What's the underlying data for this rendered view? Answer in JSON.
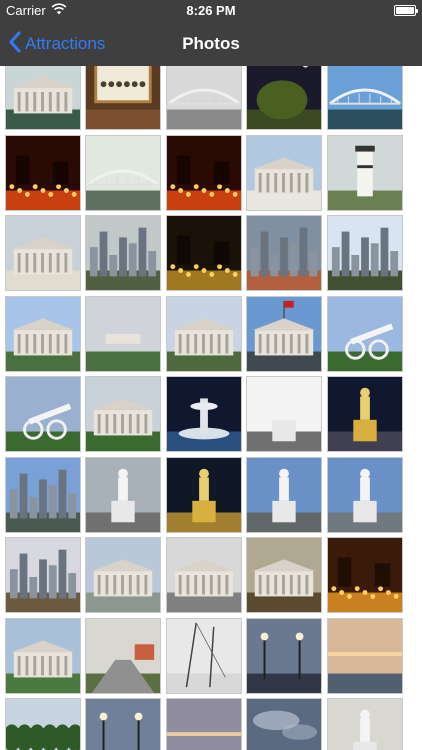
{
  "status_bar": {
    "carrier": "Carrier",
    "time": "8:26 PM",
    "wifi_icon": "wifi-icon",
    "battery_icon": "battery-icon",
    "battery_level": 1.0
  },
  "nav": {
    "back_label": "Attractions",
    "back_icon": "chevron-left-icon",
    "title": "Photos",
    "bar_color": "#3f3f3f",
    "accent_color": "#2f7cf6"
  },
  "photos": [
    {
      "sky": "#c9d6d6",
      "ground": "#3a5a4a",
      "subject": "building"
    },
    {
      "sky": "#5a3a20",
      "ground": "#7a5030",
      "subject": "framed-photo"
    },
    {
      "sky": "#d8d8d8",
      "ground": "#8a8a8a",
      "subject": "bridge"
    },
    {
      "sky": "#1a1a2a",
      "ground": "#3b4a20",
      "subject": "night-tree"
    },
    {
      "sky": "#6aa0d8",
      "ground": "#2a5060",
      "subject": "bridge"
    },
    {
      "sky": "#2a0a05",
      "ground": "#c84010",
      "subject": "night-lights"
    },
    {
      "sky": "#e0e8e0",
      "ground": "#607060",
      "subject": "bridge"
    },
    {
      "sky": "#2a0a05",
      "ground": "#c84010",
      "subject": "night-lights"
    },
    {
      "sky": "#b0c8e0",
      "ground": "#e8e8e0",
      "subject": "building"
    },
    {
      "sky": "#d0d8d8",
      "ground": "#6a8050",
      "subject": "tower"
    },
    {
      "sky": "#c8d0d8",
      "ground": "#e0dcd0",
      "subject": "building"
    },
    {
      "sky": "#c0c8c8",
      "ground": "#506040",
      "subject": "skyline"
    },
    {
      "sky": "#1a1208",
      "ground": "#a07820",
      "subject": "night-lights"
    },
    {
      "sky": "#8090a0",
      "ground": "#b06040",
      "subject": "skyline"
    },
    {
      "sky": "#d8e4f0",
      "ground": "#405030",
      "subject": "skyline"
    },
    {
      "sky": "#a8c4e8",
      "ground": "#4a7040",
      "subject": "building"
    },
    {
      "sky": "#d0d4d8",
      "ground": "#4a7040",
      "subject": "lawn"
    },
    {
      "sky": "#c8d4e4",
      "ground": "#506a40",
      "subject": "building"
    },
    {
      "sky": "#6a98d0",
      "ground": "#404850",
      "subject": "flag-building"
    },
    {
      "sky": "#9ab8e0",
      "ground": "#3a6a30",
      "subject": "cannon"
    },
    {
      "sky": "#9ab0d0",
      "ground": "#3a6a30",
      "subject": "cannon"
    },
    {
      "sky": "#c8d0d8",
      "ground": "#3a6a30",
      "subject": "building"
    },
    {
      "sky": "#101830",
      "ground": "#2a5080",
      "subject": "fountain"
    },
    {
      "sky": "#f4f4f4",
      "ground": "#707070",
      "subject": "statue"
    },
    {
      "sky": "#101830",
      "ground": "#404050",
      "subject": "statue-night"
    },
    {
      "sky": "#7aa0d8",
      "ground": "#4a5a50",
      "subject": "skyline"
    },
    {
      "sky": "#a8b0b8",
      "ground": "#707070",
      "subject": "statue"
    },
    {
      "sky": "#101828",
      "ground": "#a08030",
      "subject": "statue-night"
    },
    {
      "sky": "#6a90c8",
      "ground": "#606868",
      "subject": "statue"
    },
    {
      "sky": "#6a90c8",
      "ground": "#707880",
      "subject": "statue"
    },
    {
      "sky": "#d8d8e0",
      "ground": "#6a5a40",
      "subject": "skyline"
    },
    {
      "sky": "#b8c8d8",
      "ground": "#8a9890",
      "subject": "building"
    },
    {
      "sky": "#d8d8d8",
      "ground": "#808080",
      "subject": "building"
    },
    {
      "sky": "#b0a890",
      "ground": "#5a4a30",
      "subject": "building"
    },
    {
      "sky": "#3a1a08",
      "ground": "#c88020",
      "subject": "night-lights"
    },
    {
      "sky": "#a8c0d8",
      "ground": "#4a7a40",
      "subject": "building"
    },
    {
      "sky": "#d8d8d0",
      "ground": "#5a7040",
      "subject": "street"
    },
    {
      "sky": "#e8e8e8",
      "ground": "#d8d8d8",
      "subject": "masts"
    },
    {
      "sky": "#6a7890",
      "ground": "#303848",
      "subject": "lamps"
    },
    {
      "sky": "#d8b898",
      "ground": "#506070",
      "subject": "sunset"
    },
    {
      "sky": "#c8d4e0",
      "ground": "#3a6030",
      "subject": "trees"
    },
    {
      "sky": "#708098",
      "ground": "#404858",
      "subject": "lamps"
    },
    {
      "sky": "#908ca0",
      "ground": "#505868",
      "subject": "sunset"
    },
    {
      "sky": "#5a6a80",
      "ground": "#303848",
      "subject": "clouds"
    },
    {
      "sky": "#d8d8d0",
      "ground": "#8a8070",
      "subject": "statue"
    }
  ]
}
